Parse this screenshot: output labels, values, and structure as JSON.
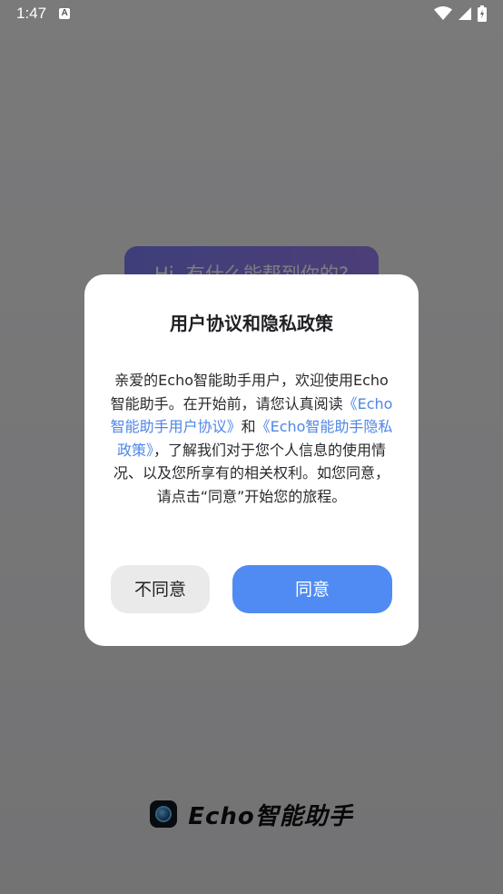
{
  "status_bar": {
    "time": "1:47",
    "notification_icon": "A"
  },
  "app": {
    "greeting": "Hi, 有什么能帮到你的?",
    "brand_name": "Echo智能助手"
  },
  "dialog": {
    "title": "用户协议和隐私政策",
    "body_part1": "亲爱的Echo智能助手用户，欢迎使用Echo智能助手。在开始前，请您认真阅读",
    "user_agreement_link": "《Echo智能助手用户协议》",
    "body_and": "和",
    "privacy_policy_link": "《Echo智能助手隐私政策》",
    "body_part2": "，了解我们对于您个人信息的使用情况、以及您所享有的相关权利。如您同意，请点击“同意”开始您的旅程。",
    "decline_label": "不同意",
    "accept_label": "同意"
  },
  "colors": {
    "accent": "#4f8bf2",
    "link": "#4e86e8",
    "decline_bg": "#eaeaea"
  }
}
